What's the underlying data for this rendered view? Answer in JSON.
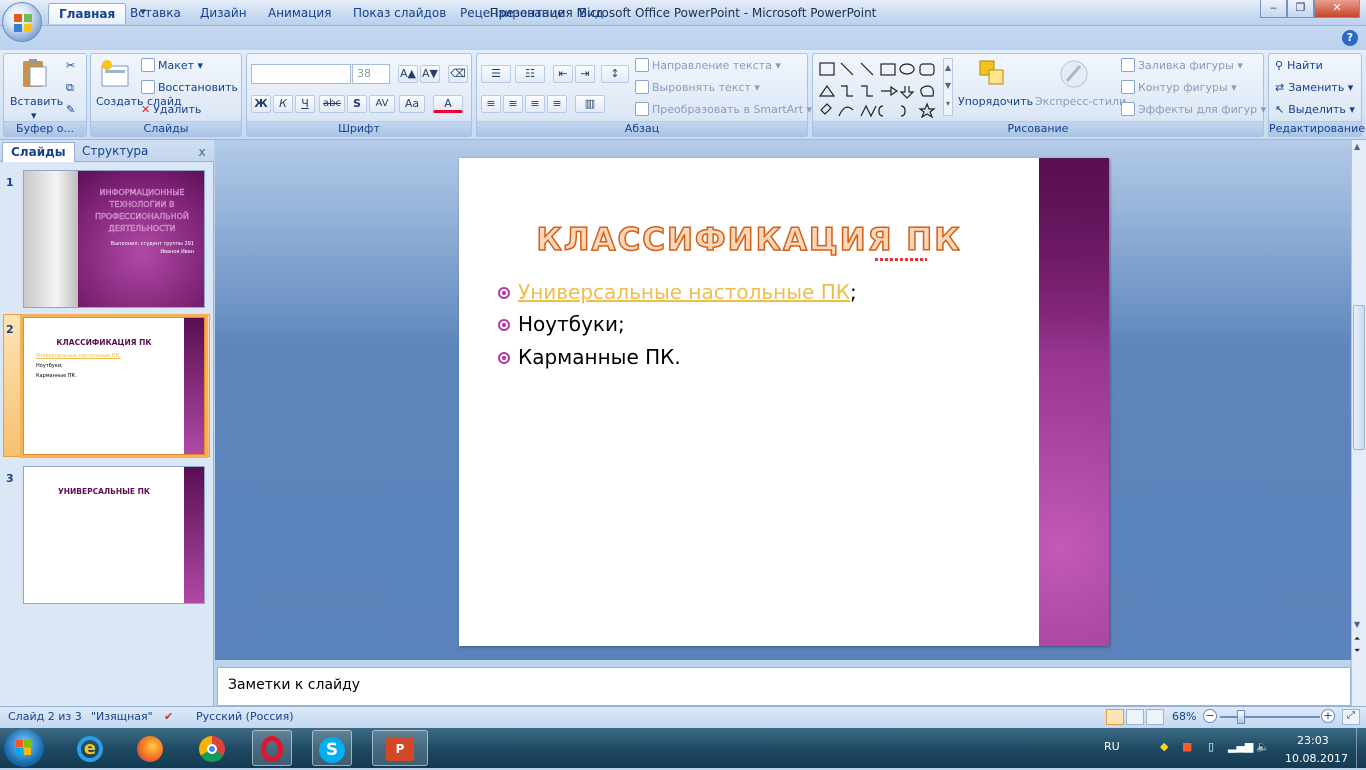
{
  "window": {
    "title": "Презентация Microsoft Office PowerPoint - Microsoft PowerPoint",
    "minimize": "‒",
    "maximize": "❐",
    "close": "✕"
  },
  "ribbon_tabs": [
    "Главная",
    "Вставка",
    "Дизайн",
    "Анимация",
    "Показ слайдов",
    "Рецензирование",
    "Вид"
  ],
  "help": "?",
  "ribbon": {
    "clipboard": {
      "label": "Буфер о...",
      "paste": "Вставить"
    },
    "slides": {
      "label": "Слайды",
      "new_slide": "Создать слайд",
      "layout": "Макет",
      "reset": "Восстановить",
      "delete": "Удалить"
    },
    "font": {
      "label": "Шрифт",
      "font_name": "",
      "font_size": "38",
      "bold": "Ж",
      "italic": "К",
      "underline": "Ч",
      "strike": "abc",
      "shadow": "S",
      "spacing": "AV",
      "case": "Aa",
      "color": "A"
    },
    "paragraph": {
      "label": "Абзац",
      "text_direction": "Направление текста",
      "align_text": "Выровнять текст",
      "smartart": "Преобразовать в SmartArt"
    },
    "drawing": {
      "label": "Рисование",
      "arrange": "Упорядочить",
      "quick_styles": "Экспресс-стили",
      "fill": "Заливка фигуры",
      "outline": "Контур фигуры",
      "effects": "Эффекты для фигур"
    },
    "editing": {
      "label": "Редактирование",
      "find": "Найти",
      "replace": "Заменить",
      "select": "Выделить"
    }
  },
  "panel": {
    "tab_slides": "Слайды",
    "tab_outline": "Структура",
    "close": "x",
    "thumbs": [
      {
        "num": "1",
        "title": "ИНФОРМАЦИОННЫЕ ТЕХНОЛОГИИ В ПРОФЕССИОНАЛЬНОЙ ДЕЯТЕЛЬНОСТИ",
        "sub1": "Выполнил: студент группы 291",
        "sub2": "Иванов Иван"
      },
      {
        "num": "2",
        "title": "КЛАССИФИКАЦИЯ ПК",
        "items": [
          "Универсальные настольные ПК;",
          "Ноутбуки;",
          "Карманные ПК."
        ]
      },
      {
        "num": "3",
        "title": "УНИВЕРСАЛЬНЫЕ ПК"
      }
    ]
  },
  "slide": {
    "title": "КЛАССИФИКАЦИЯ ПК",
    "bullet1_link": "Универсальные настольные ПК",
    "bullet1_tail": ";",
    "bullet2": "Ноутбуки;",
    "bullet3": "Карманные ПК."
  },
  "notes_placeholder": "Заметки к слайду",
  "status": {
    "slide_info": "Слайд 2 из 3",
    "theme": "\"Изящная\"",
    "language": "Русский (Россия)",
    "zoom": "68%",
    "zoom_level": 0.68
  },
  "taskbar": {
    "lang": "RU",
    "time": "23:03",
    "date": "10.08.2017"
  },
  "colors": {
    "accent": "#b63aa9",
    "title_fill": "#fbd7b7",
    "title_stroke": "#d2601a",
    "link": "#f0bd4c"
  }
}
